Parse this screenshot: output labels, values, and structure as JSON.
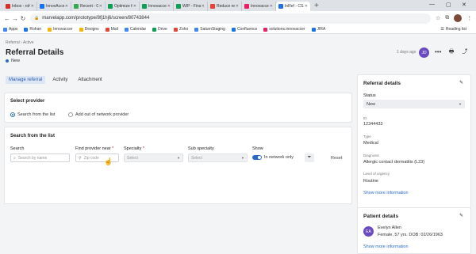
{
  "browser": {
    "tabs": [
      {
        "label": "Inbox - rohan",
        "color": "#d93025"
      },
      {
        "label": "InnovAccer",
        "color": "#1a73e8"
      },
      {
        "label": "Recent - Go",
        "color": "#34a853"
      },
      {
        "label": "Optimize fo",
        "color": "#0f9d58"
      },
      {
        "label": "Innovaccer",
        "color": "#0f9d58"
      },
      {
        "label": "WIP - Final",
        "color": "#0f9d58"
      },
      {
        "label": "Reduce rev",
        "color": "#ea4335"
      },
      {
        "label": "Innovaccer",
        "color": "#e91e63"
      },
      {
        "label": "InRef - CSS",
        "color": "#1a73e8"
      }
    ],
    "url": "marvelapp.com/prototype/8fj1hj6/screen/80743844",
    "bookmarks": [
      {
        "label": "Apps",
        "color": "#4285f4"
      },
      {
        "label": "Rohan",
        "color": "#1a73e8"
      },
      {
        "label": "Innovaccer",
        "color": "#f4b400"
      },
      {
        "label": "Designs",
        "color": "#f4b400"
      },
      {
        "label": "Mail",
        "color": "#ea4335"
      },
      {
        "label": "Calendar",
        "color": "#4285f4"
      },
      {
        "label": "Drive",
        "color": "#0f9d58"
      },
      {
        "label": "Zoho",
        "color": "#ea4335"
      },
      {
        "label": "SaturnStaging",
        "color": "#4285f4"
      },
      {
        "label": "Confluence",
        "color": "#1a73e8"
      },
      {
        "label": "solutions.innovaccer",
        "color": "#e91e63"
      },
      {
        "label": "JIRA",
        "color": "#1a73e8"
      }
    ],
    "reading_list": "Reading list"
  },
  "header": {
    "breadcrumb": "Referral › Active",
    "title": "Referral Details",
    "status": "New",
    "age": "1 days ago",
    "avatar_initials": "JD"
  },
  "tabs": [
    "Manage referral",
    "Activity",
    "Attachment"
  ],
  "select_provider": {
    "title": "Select provider",
    "options": [
      "Search from the list",
      "Add out of network provider"
    ]
  },
  "search": {
    "title": "Search from the list",
    "fields": {
      "search_label": "Search",
      "search_placeholder": "Search by name",
      "near_label": "Find provider near",
      "near_placeholder": "Zip code",
      "specialty_label": "Specialty",
      "specialty_placeholder": "Select",
      "sub_label": "Sub specialty",
      "sub_placeholder": "Select",
      "show_label": "Show",
      "toggle_label": "In network only",
      "reset_label": "Reset"
    }
  },
  "referral_panel": {
    "title": "Referral details",
    "status_label": "Status",
    "status_value": "New",
    "id_label": "ID",
    "id_value": "12344433",
    "type_label": "Type",
    "type_value": "Medical",
    "diagnosis_label": "Diagnosis",
    "diagnosis_value": "Allergic contact dermatitis (L23)",
    "urgency_label": "Level of urgency",
    "urgency_value": "Routine",
    "more_link": "Show more information"
  },
  "patient_panel": {
    "title": "Patient details",
    "initials": "EA",
    "name": "Evelyn Allen",
    "details": "Female, 57 yrs. DOB: 02/26/1963",
    "more_link": "Show more information"
  }
}
